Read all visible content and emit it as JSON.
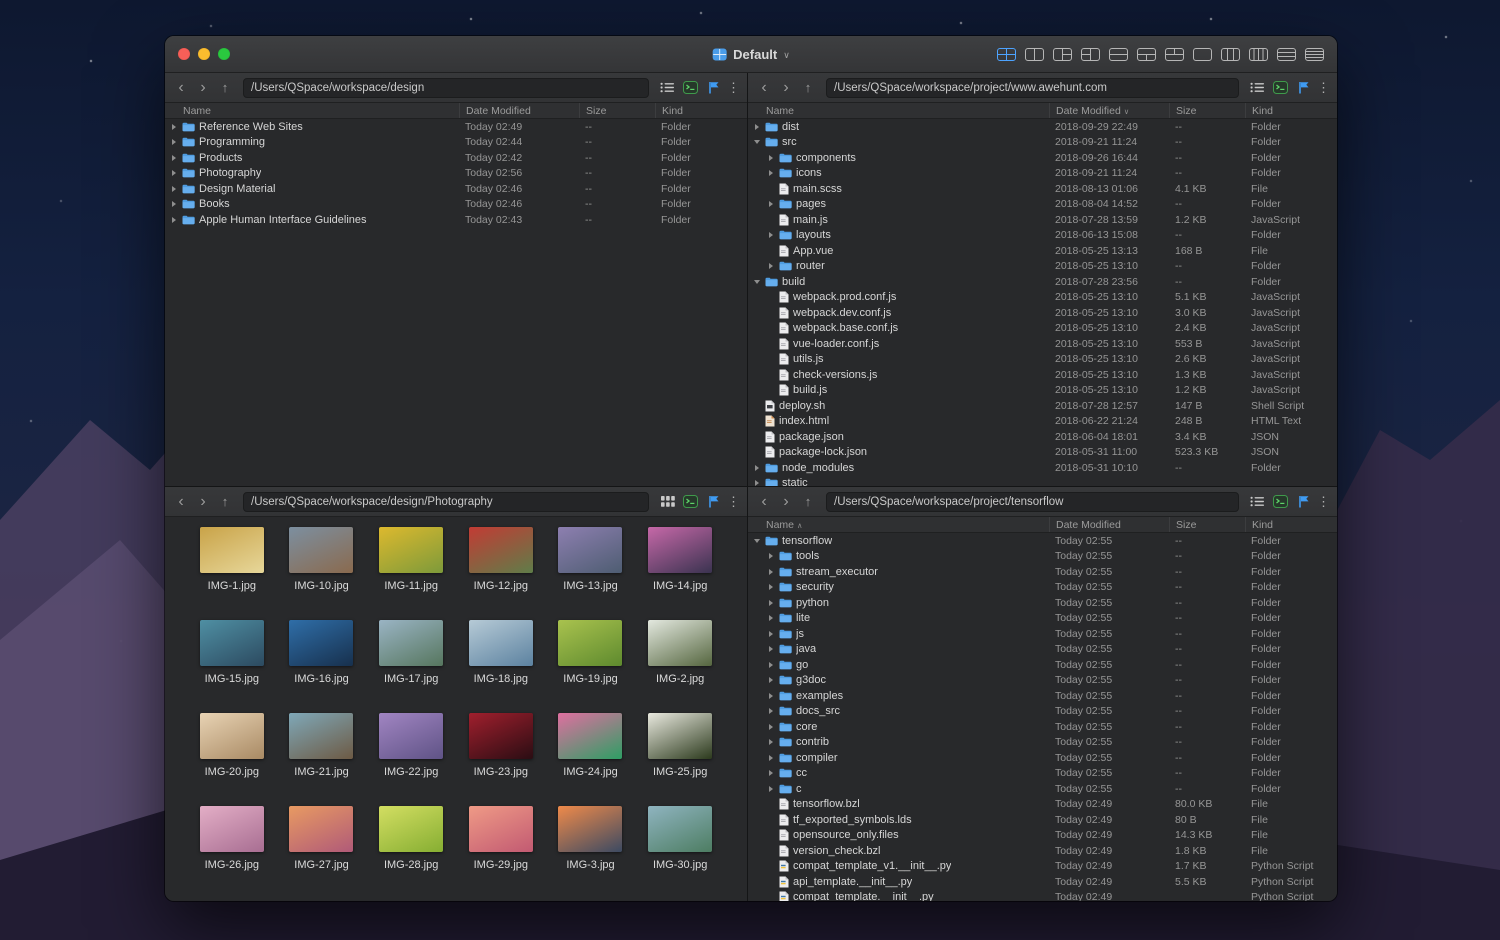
{
  "icons": {
    "back": "‹",
    "forward": "›",
    "up": "↑",
    "more": "⋮",
    "chevron_down": "∨"
  },
  "window": {
    "title": "Default",
    "layout_icons": [
      {
        "pattern": "quad",
        "active": true
      },
      {
        "pattern": "cols2",
        "active": false
      },
      {
        "pattern": "rsplit",
        "active": false
      },
      {
        "pattern": "lsplit",
        "active": false
      },
      {
        "pattern": "rows2",
        "active": false
      },
      {
        "pattern": "bsplit",
        "active": false
      },
      {
        "pattern": "tsplit",
        "active": false
      },
      {
        "pattern": "single",
        "active": false
      },
      {
        "pattern": "cols3",
        "active": false
      },
      {
        "pattern": "cols4",
        "active": false
      },
      {
        "pattern": "rows3",
        "active": false
      },
      {
        "pattern": "rows4",
        "active": false
      }
    ]
  },
  "panes": {
    "top_left": {
      "path": "/Users/QSpace/workspace/design",
      "columns": [
        {
          "label": "Name",
          "sort": ""
        },
        {
          "label": "Date Modified",
          "sort": ""
        },
        {
          "label": "Size",
          "sort": ""
        },
        {
          "label": "Kind",
          "sort": ""
        }
      ],
      "rows": [
        {
          "name": "Reference Web Sites",
          "date": "Today 02:49",
          "size": "--",
          "kind": "Folder",
          "type": "folder",
          "indent": 0,
          "disclosure": "collapsed"
        },
        {
          "name": "Programming",
          "date": "Today 02:44",
          "size": "--",
          "kind": "Folder",
          "type": "folder",
          "indent": 0,
          "disclosure": "collapsed"
        },
        {
          "name": "Products",
          "date": "Today 02:42",
          "size": "--",
          "kind": "Folder",
          "type": "folder",
          "indent": 0,
          "disclosure": "collapsed"
        },
        {
          "name": "Photography",
          "date": "Today 02:56",
          "size": "--",
          "kind": "Folder",
          "type": "folder",
          "indent": 0,
          "disclosure": "collapsed"
        },
        {
          "name": "Design Material",
          "date": "Today 02:46",
          "size": "--",
          "kind": "Folder",
          "type": "folder",
          "indent": 0,
          "disclosure": "collapsed"
        },
        {
          "name": "Books",
          "date": "Today 02:46",
          "size": "--",
          "kind": "Folder",
          "type": "folder",
          "indent": 0,
          "disclosure": "collapsed"
        },
        {
          "name": "Apple Human Interface Guidelines",
          "date": "Today 02:43",
          "size": "--",
          "kind": "Folder",
          "type": "folder",
          "indent": 0,
          "disclosure": "collapsed"
        }
      ]
    },
    "top_right": {
      "path": "/Users/QSpace/workspace/project/www.awehunt.com",
      "columns": [
        {
          "label": "Name",
          "sort": ""
        },
        {
          "label": "Date Modified",
          "sort": "∨"
        },
        {
          "label": "Size",
          "sort": ""
        },
        {
          "label": "Kind",
          "sort": ""
        }
      ],
      "rows": [
        {
          "name": "dist",
          "date": "2018-09-29 22:49",
          "size": "--",
          "kind": "Folder",
          "type": "folder",
          "indent": 0,
          "disclosure": "collapsed"
        },
        {
          "name": "src",
          "date": "2018-09-21 11:24",
          "size": "--",
          "kind": "Folder",
          "type": "folder",
          "indent": 0,
          "disclosure": "expanded"
        },
        {
          "name": "components",
          "date": "2018-09-26 16:44",
          "size": "--",
          "kind": "Folder",
          "type": "folder",
          "indent": 1,
          "disclosure": "collapsed"
        },
        {
          "name": "icons",
          "date": "2018-09-21 11:24",
          "size": "--",
          "kind": "Folder",
          "type": "folder",
          "indent": 1,
          "disclosure": "collapsed"
        },
        {
          "name": "main.scss",
          "date": "2018-08-13 01:06",
          "size": "4.1 KB",
          "kind": "File",
          "type": "file",
          "indent": 1
        },
        {
          "name": "pages",
          "date": "2018-08-04 14:52",
          "size": "--",
          "kind": "Folder",
          "type": "folder",
          "indent": 1,
          "disclosure": "collapsed"
        },
        {
          "name": "main.js",
          "date": "2018-07-28 13:59",
          "size": "1.2 KB",
          "kind": "JavaScript",
          "type": "js",
          "indent": 1
        },
        {
          "name": "layouts",
          "date": "2018-06-13 15:08",
          "size": "--",
          "kind": "Folder",
          "type": "folder",
          "indent": 1,
          "disclosure": "collapsed"
        },
        {
          "name": "App.vue",
          "date": "2018-05-25 13:13",
          "size": "168 B",
          "kind": "File",
          "type": "file",
          "indent": 1
        },
        {
          "name": "router",
          "date": "2018-05-25 13:10",
          "size": "--",
          "kind": "Folder",
          "type": "folder",
          "indent": 1,
          "disclosure": "collapsed"
        },
        {
          "name": "build",
          "date": "2018-07-28 23:56",
          "size": "--",
          "kind": "Folder",
          "type": "folder",
          "indent": 0,
          "disclosure": "expanded"
        },
        {
          "name": "webpack.prod.conf.js",
          "date": "2018-05-25 13:10",
          "size": "5.1 KB",
          "kind": "JavaScript",
          "type": "js",
          "indent": 1
        },
        {
          "name": "webpack.dev.conf.js",
          "date": "2018-05-25 13:10",
          "size": "3.0 KB",
          "kind": "JavaScript",
          "type": "js",
          "indent": 1
        },
        {
          "name": "webpack.base.conf.js",
          "date": "2018-05-25 13:10",
          "size": "2.4 KB",
          "kind": "JavaScript",
          "type": "js",
          "indent": 1
        },
        {
          "name": "vue-loader.conf.js",
          "date": "2018-05-25 13:10",
          "size": "553 B",
          "kind": "JavaScript",
          "type": "js",
          "indent": 1
        },
        {
          "name": "utils.js",
          "date": "2018-05-25 13:10",
          "size": "2.6 KB",
          "kind": "JavaScript",
          "type": "js",
          "indent": 1
        },
        {
          "name": "check-versions.js",
          "date": "2018-05-25 13:10",
          "size": "1.3 KB",
          "kind": "JavaScript",
          "type": "js",
          "indent": 1
        },
        {
          "name": "build.js",
          "date": "2018-05-25 13:10",
          "size": "1.2 KB",
          "kind": "JavaScript",
          "type": "js",
          "indent": 1
        },
        {
          "name": "deploy.sh",
          "date": "2018-07-28 12:57",
          "size": "147 B",
          "kind": "Shell Script",
          "type": "sh",
          "indent": 0
        },
        {
          "name": "index.html",
          "date": "2018-06-22 21:24",
          "size": "248 B",
          "kind": "HTML Text",
          "type": "html",
          "indent": 0
        },
        {
          "name": "package.json",
          "date": "2018-06-04 18:01",
          "size": "3.4 KB",
          "kind": "JSON",
          "type": "json",
          "indent": 0
        },
        {
          "name": "package-lock.json",
          "date": "2018-05-31 11:00",
          "size": "523.3 KB",
          "kind": "JSON",
          "type": "json",
          "indent": 0
        },
        {
          "name": "node_modules",
          "date": "2018-05-31 10:10",
          "size": "--",
          "kind": "Folder",
          "type": "folder",
          "indent": 0,
          "disclosure": "collapsed"
        },
        {
          "name": "static",
          "date": "",
          "size": "",
          "kind": "",
          "type": "folder",
          "indent": 0,
          "disclosure": "collapsed"
        }
      ]
    },
    "bottom_left": {
      "path": "/Users/QSpace/workspace/design/Photography",
      "items": [
        {
          "label": "IMG-1.jpg",
          "colors": [
            "#c9a348",
            "#e7d79a"
          ]
        },
        {
          "label": "IMG-10.jpg",
          "colors": [
            "#7c8fa0",
            "#8a6a4e"
          ]
        },
        {
          "label": "IMG-11.jpg",
          "colors": [
            "#ddb92e",
            "#7d9a3a"
          ]
        },
        {
          "label": "IMG-12.jpg",
          "colors": [
            "#c23b34",
            "#5f7d49"
          ]
        },
        {
          "label": "IMG-13.jpg",
          "colors": [
            "#8d7fb0",
            "#4e5d72"
          ]
        },
        {
          "label": "IMG-14.jpg",
          "colors": [
            "#c668a8",
            "#3a3350"
          ]
        },
        {
          "label": "IMG-15.jpg",
          "colors": [
            "#4f8fa3",
            "#2c4a60"
          ]
        },
        {
          "label": "IMG-16.jpg",
          "colors": [
            "#2f6ea8",
            "#17304d"
          ]
        },
        {
          "label": "IMG-17.jpg",
          "colors": [
            "#9ab4c4",
            "#56765e"
          ]
        },
        {
          "label": "IMG-18.jpg",
          "colors": [
            "#b6cad6",
            "#5c82a0"
          ]
        },
        {
          "label": "IMG-19.jpg",
          "colors": [
            "#a9c24e",
            "#5e8a2e"
          ]
        },
        {
          "label": "IMG-2.jpg",
          "colors": [
            "#e3e8df",
            "#55663f"
          ]
        },
        {
          "label": "IMG-20.jpg",
          "colors": [
            "#e8d3b4",
            "#a98a64"
          ]
        },
        {
          "label": "IMG-21.jpg",
          "colors": [
            "#7fa8b8",
            "#6d5a44"
          ]
        },
        {
          "label": "IMG-22.jpg",
          "colors": [
            "#a185c2",
            "#5f5386"
          ]
        },
        {
          "label": "IMG-23.jpg",
          "colors": [
            "#a01f2d",
            "#2a0d13"
          ]
        },
        {
          "label": "IMG-24.jpg",
          "colors": [
            "#e06fa0",
            "#2e9e64"
          ]
        },
        {
          "label": "IMG-25.jpg",
          "colors": [
            "#e9e9df",
            "#2c3a1d"
          ]
        },
        {
          "label": "IMG-26.jpg",
          "colors": [
            "#e3aec6",
            "#a86e92"
          ]
        },
        {
          "label": "IMG-27.jpg",
          "colors": [
            "#e89a62",
            "#b05a78"
          ]
        },
        {
          "label": "IMG-28.jpg",
          "colors": [
            "#d3de62",
            "#86ae32"
          ]
        },
        {
          "label": "IMG-29.jpg",
          "colors": [
            "#ef9a86",
            "#c25a72"
          ]
        },
        {
          "label": "IMG-3.jpg",
          "colors": [
            "#ef8a4a",
            "#3c4a62"
          ]
        },
        {
          "label": "IMG-30.jpg",
          "colors": [
            "#8fb4c0",
            "#4d7d62"
          ]
        }
      ]
    },
    "bottom_right": {
      "path": "/Users/QSpace/workspace/project/tensorflow",
      "columns": [
        {
          "label": "Name",
          "sort": "∧"
        },
        {
          "label": "Date Modified",
          "sort": ""
        },
        {
          "label": "Size",
          "sort": ""
        },
        {
          "label": "Kind",
          "sort": ""
        }
      ],
      "rows": [
        {
          "name": "tensorflow",
          "date": "Today 02:55",
          "size": "--",
          "kind": "Folder",
          "type": "folder",
          "indent": 0,
          "disclosure": "expanded"
        },
        {
          "name": "tools",
          "date": "Today 02:55",
          "size": "--",
          "kind": "Folder",
          "type": "folder",
          "indent": 1,
          "disclosure": "collapsed"
        },
        {
          "name": "stream_executor",
          "date": "Today 02:55",
          "size": "--",
          "kind": "Folder",
          "type": "folder",
          "indent": 1,
          "disclosure": "collapsed"
        },
        {
          "name": "security",
          "date": "Today 02:55",
          "size": "--",
          "kind": "Folder",
          "type": "folder",
          "indent": 1,
          "disclosure": "collapsed"
        },
        {
          "name": "python",
          "date": "Today 02:55",
          "size": "--",
          "kind": "Folder",
          "type": "folder",
          "indent": 1,
          "disclosure": "collapsed"
        },
        {
          "name": "lite",
          "date": "Today 02:55",
          "size": "--",
          "kind": "Folder",
          "type": "folder",
          "indent": 1,
          "disclosure": "collapsed"
        },
        {
          "name": "js",
          "date": "Today 02:55",
          "size": "--",
          "kind": "Folder",
          "type": "folder",
          "indent": 1,
          "disclosure": "collapsed"
        },
        {
          "name": "java",
          "date": "Today 02:55",
          "size": "--",
          "kind": "Folder",
          "type": "folder",
          "indent": 1,
          "disclosure": "collapsed"
        },
        {
          "name": "go",
          "date": "Today 02:55",
          "size": "--",
          "kind": "Folder",
          "type": "folder",
          "indent": 1,
          "disclosure": "collapsed"
        },
        {
          "name": "g3doc",
          "date": "Today 02:55",
          "size": "--",
          "kind": "Folder",
          "type": "folder",
          "indent": 1,
          "disclosure": "collapsed"
        },
        {
          "name": "examples",
          "date": "Today 02:55",
          "size": "--",
          "kind": "Folder",
          "type": "folder",
          "indent": 1,
          "disclosure": "collapsed"
        },
        {
          "name": "docs_src",
          "date": "Today 02:55",
          "size": "--",
          "kind": "Folder",
          "type": "folder",
          "indent": 1,
          "disclosure": "collapsed"
        },
        {
          "name": "core",
          "date": "Today 02:55",
          "size": "--",
          "kind": "Folder",
          "type": "folder",
          "indent": 1,
          "disclosure": "collapsed"
        },
        {
          "name": "contrib",
          "date": "Today 02:55",
          "size": "--",
          "kind": "Folder",
          "type": "folder",
          "indent": 1,
          "disclosure": "collapsed"
        },
        {
          "name": "compiler",
          "date": "Today 02:55",
          "size": "--",
          "kind": "Folder",
          "type": "folder",
          "indent": 1,
          "disclosure": "collapsed"
        },
        {
          "name": "cc",
          "date": "Today 02:55",
          "size": "--",
          "kind": "Folder",
          "type": "folder",
          "indent": 1,
          "disclosure": "collapsed"
        },
        {
          "name": "c",
          "date": "Today 02:55",
          "size": "--",
          "kind": "Folder",
          "type": "folder",
          "indent": 1,
          "disclosure": "collapsed"
        },
        {
          "name": "tensorflow.bzl",
          "date": "Today 02:49",
          "size": "80.0 KB",
          "kind": "File",
          "type": "file",
          "indent": 1
        },
        {
          "name": "tf_exported_symbols.lds",
          "date": "Today 02:49",
          "size": "80 B",
          "kind": "File",
          "type": "file",
          "indent": 1
        },
        {
          "name": "opensource_only.files",
          "date": "Today 02:49",
          "size": "14.3 KB",
          "kind": "File",
          "type": "file",
          "indent": 1
        },
        {
          "name": "version_check.bzl",
          "date": "Today 02:49",
          "size": "1.8 KB",
          "kind": "File",
          "type": "file",
          "indent": 1
        },
        {
          "name": "compat_template_v1.__init__.py",
          "date": "Today 02:49",
          "size": "1.7 KB",
          "kind": "Python Script",
          "type": "py",
          "indent": 1
        },
        {
          "name": "api_template.__init__.py",
          "date": "Today 02:49",
          "size": "5.5 KB",
          "kind": "Python Script",
          "type": "py",
          "indent": 1
        },
        {
          "name": "compat_template.__init__.py",
          "date": "Today 02:49",
          "size": "",
          "kind": "Python Script",
          "type": "py",
          "indent": 1
        }
      ]
    }
  }
}
